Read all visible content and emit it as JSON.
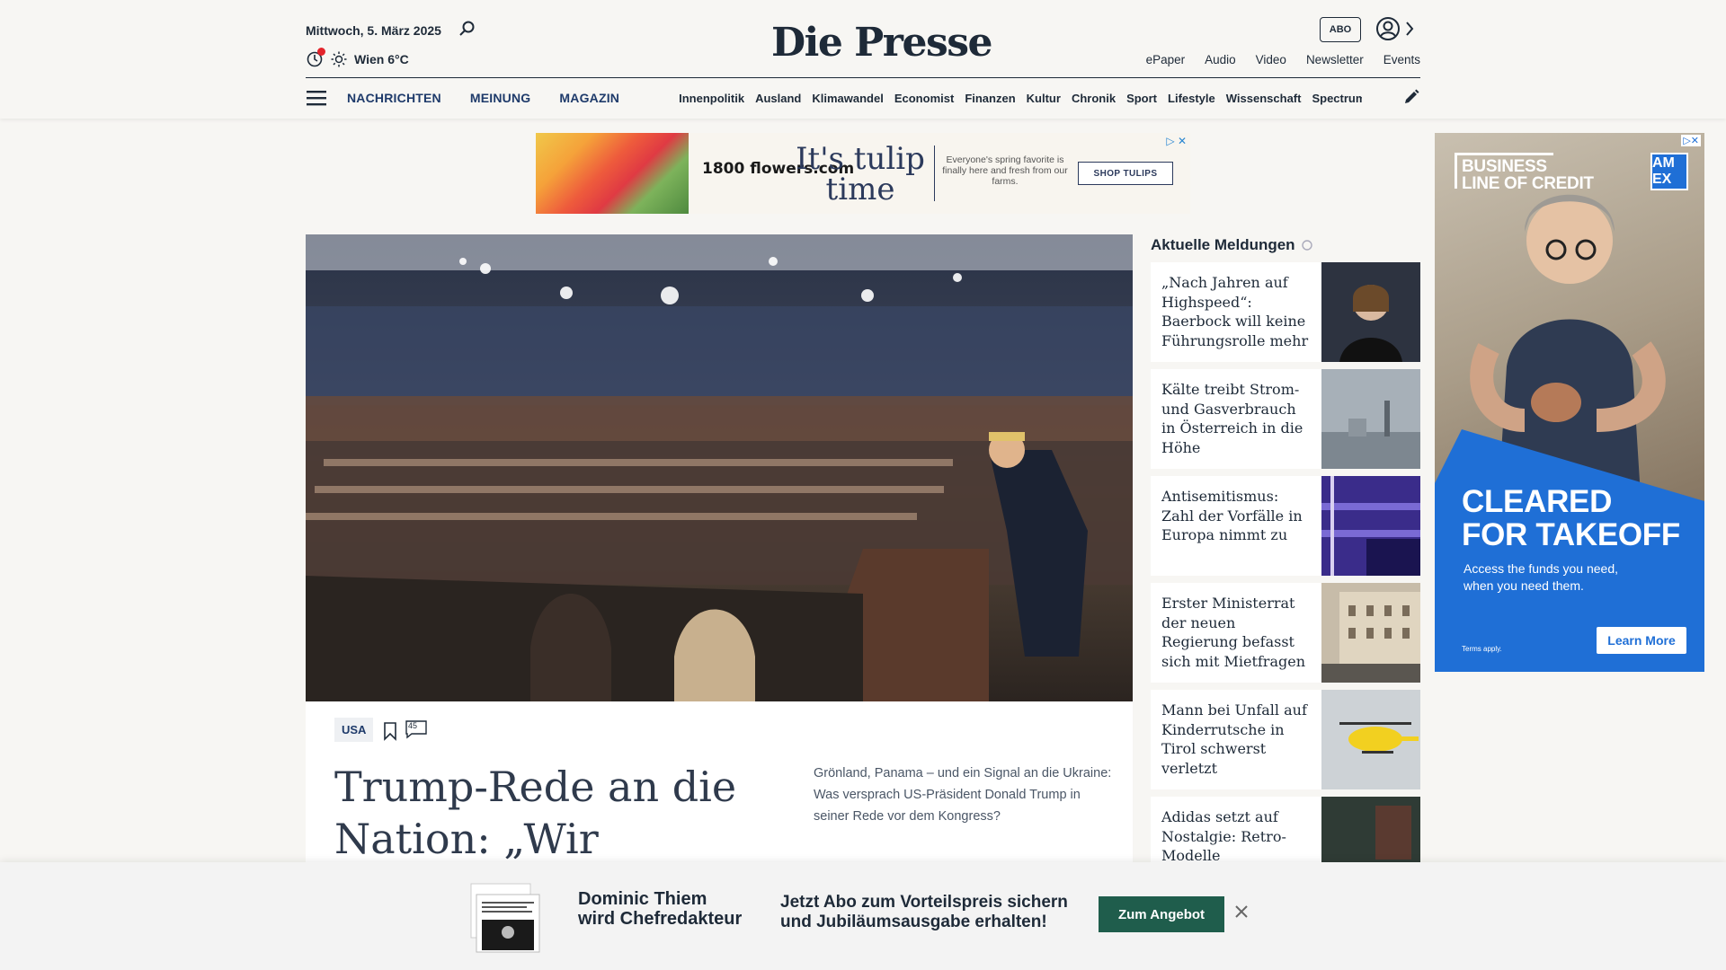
{
  "header": {
    "date": "Mittwoch, 5. März 2025",
    "weather": "Wien 6°C",
    "logo": "Die Presse",
    "abo_label": "ABO",
    "top_links": [
      "ePaper",
      "Audio",
      "Video",
      "Newsletter",
      "Events"
    ]
  },
  "nav": {
    "main": [
      "NACHRICHTEN",
      "MEINUNG",
      "MAGAZIN"
    ],
    "sub": [
      "Innenpolitik",
      "Ausland",
      "Klimawandel",
      "Economist",
      "Finanzen",
      "Kultur",
      "Chronik",
      "Sport",
      "Lifestyle",
      "Wissenschaft",
      "Spectrum"
    ]
  },
  "ad_top": {
    "brand": "1800 flowers.com",
    "tagline_1": "It's tulip",
    "tagline_2": "time",
    "copy": "Everyone's spring favorite is finally here and fresh from our farms.",
    "button": "SHOP TULIPS",
    "close": "▷ ✕"
  },
  "hero": {
    "tag": "USA",
    "comment_count": "45",
    "headline": "Trump-Rede an die Nation: „Wir stehen",
    "teaser": "Grönland, Panama – und ein Signal an die Ukraine: Was versprach US-Präsident Donald Trump in seiner Rede vor dem Kongress?"
  },
  "news": {
    "title": "Aktuelle Meldungen",
    "items": [
      {
        "text": "„Nach Jahren auf Highspeed“: Baerbock will keine Führungsrolle mehr",
        "thumb_color": "#3a3f4a"
      },
      {
        "text": "Kälte treibt Strom- und Gasverbrauch in Österreich in die Höhe",
        "thumb_color": "#9aa4ad"
      },
      {
        "text": "Antisemitismus: Zahl der Vorfälle in Europa nimmt zu",
        "thumb_color": "#4b3c9e"
      },
      {
        "text": "Erster Ministerrat der neuen Regierung befasst sich mit Mietfragen",
        "thumb_color": "#b9ab94"
      },
      {
        "text": "Mann bei Unfall auf Kinderrutsche in Tirol schwerst verletzt",
        "thumb_color": "#c7ccd0"
      },
      {
        "text": "Adidas setzt auf Nostalgie: Retro-Modelle",
        "thumb_color": "#2e3a34"
      }
    ]
  },
  "ad_right": {
    "line_1": "BUSINESS",
    "line_2": "LINE OF CREDIT",
    "logo": "AM EX",
    "headline_1": "CLEARED",
    "headline_2": "FOR TAKEOFF",
    "sub": "Access the funds you need, when you need them.",
    "terms": "Terms apply.",
    "button": "Learn More",
    "close": "▷✕"
  },
  "bottom_bar": {
    "headline_1": "Dominic Thiem",
    "headline_2": "wird Chefredakteur",
    "offer_1": "Jetzt Abo zum Vorteilspreis sichern",
    "offer_2": "und Jubiläumsausgabe erhalten!",
    "button": "Zum Angebot"
  },
  "colors": {
    "background": "#f7f6f3",
    "text": "#1e2a38",
    "nav_blue": "#1e3a6a",
    "cta_green": "#1f5d4c",
    "alert_red": "#e3242b",
    "amex_blue": "#1f6fd6"
  }
}
